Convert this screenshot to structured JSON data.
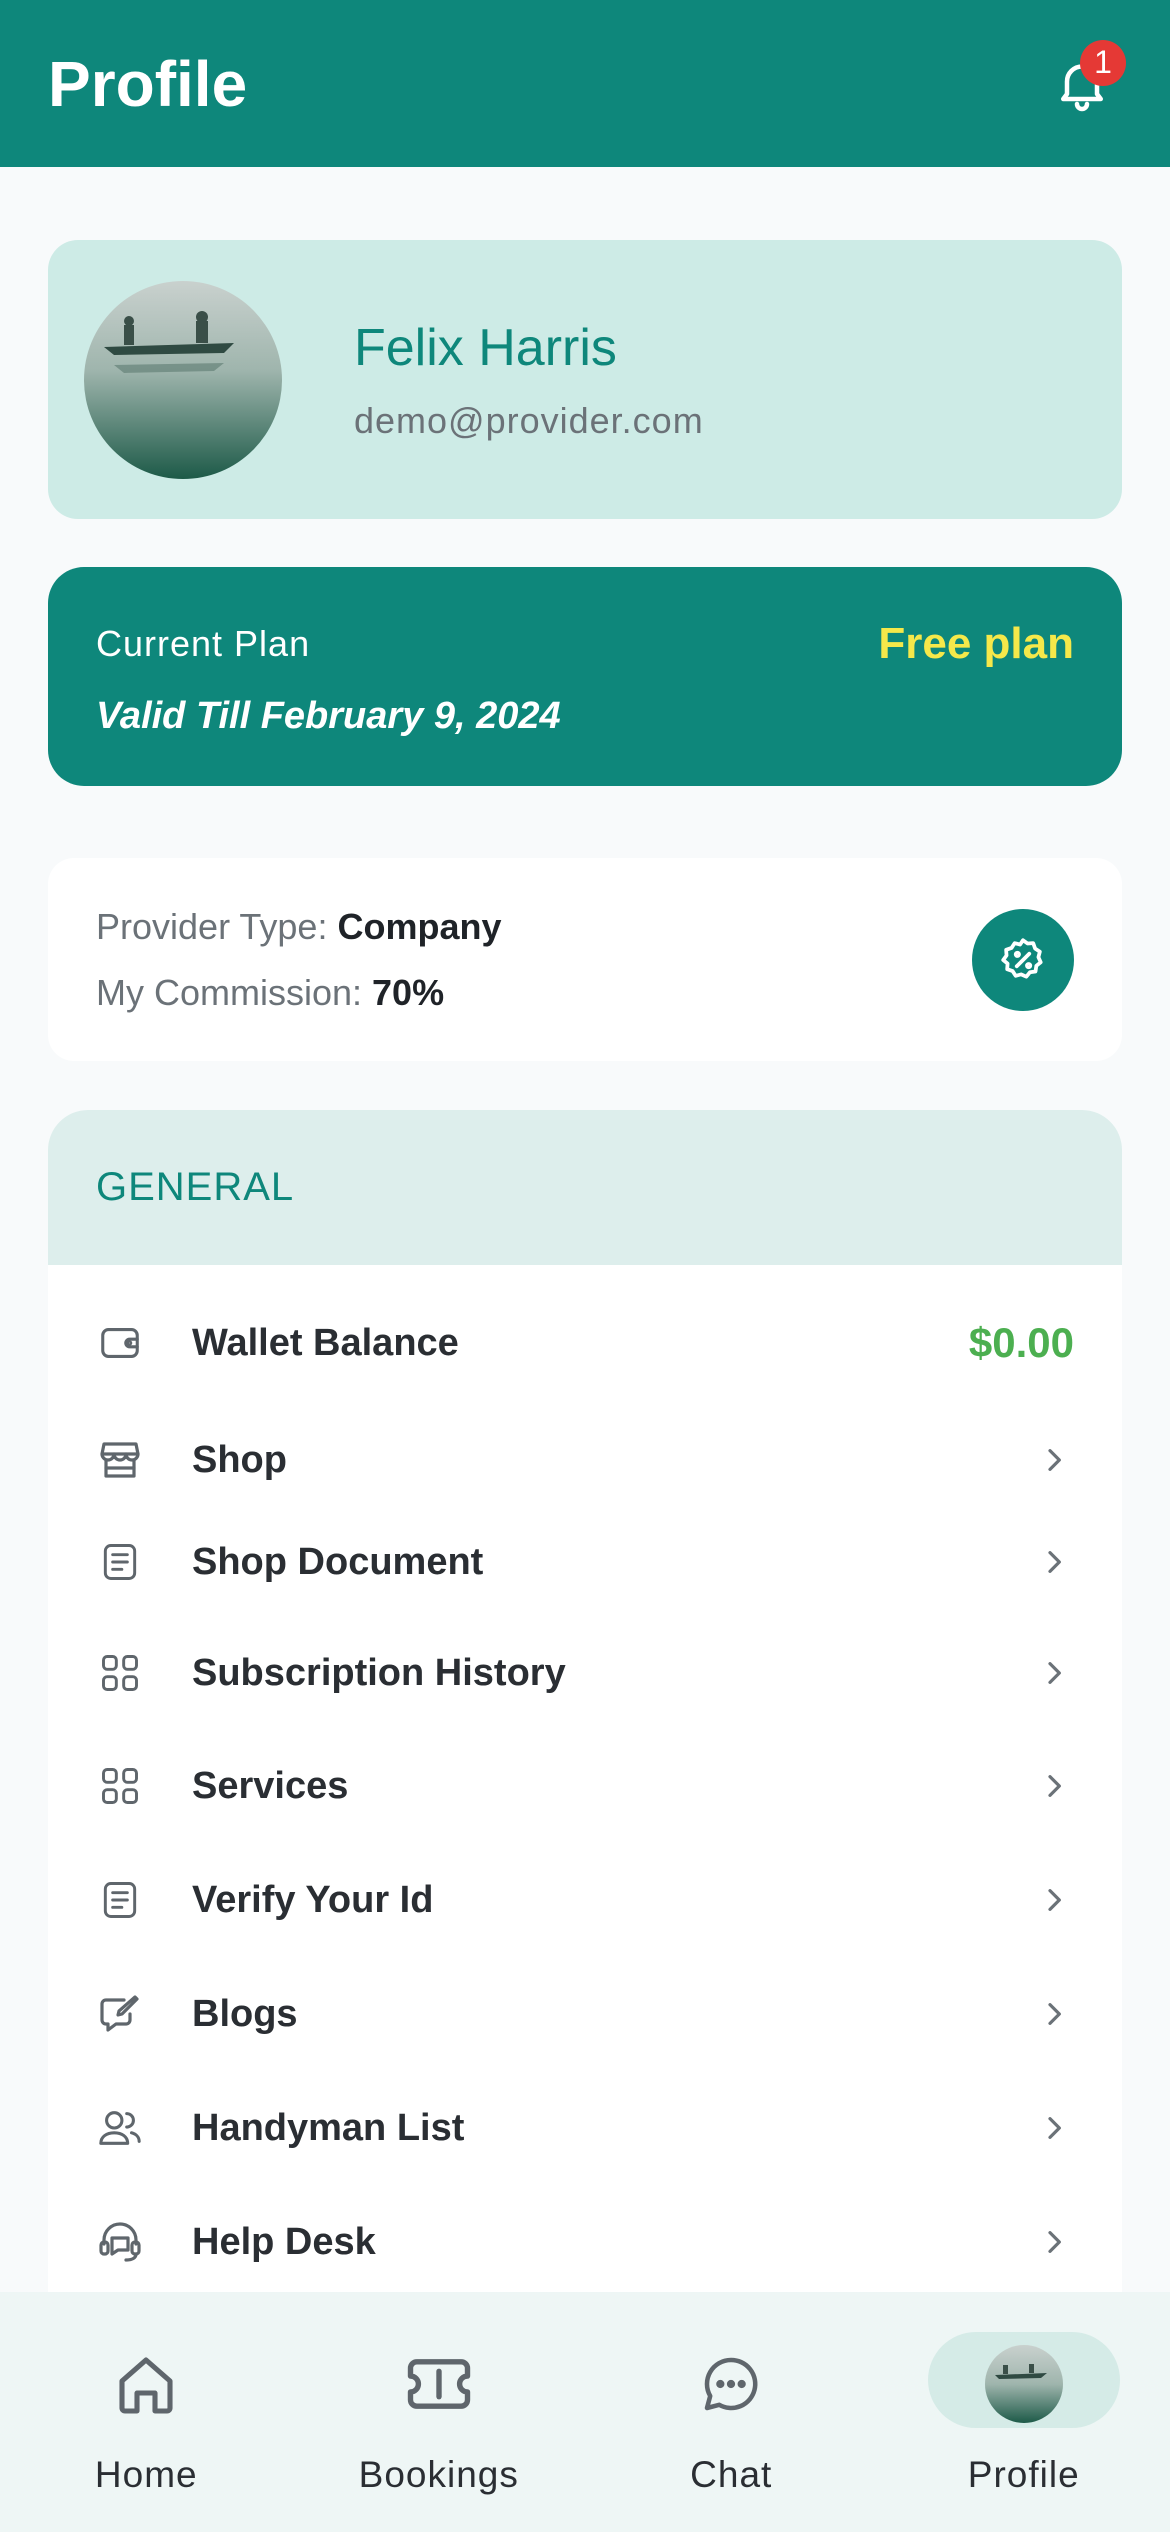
{
  "header": {
    "title": "Profile",
    "notification_count": "1"
  },
  "profile": {
    "name": "Felix Harris",
    "email": "demo@provider.com"
  },
  "plan": {
    "label": "Current Plan",
    "name": "Free plan",
    "valid": "Valid Till February 9, 2024"
  },
  "provider": {
    "type_label": "Provider Type: ",
    "type_value": "Company",
    "commission_label": "My Commission: ",
    "commission_value": "70%"
  },
  "general": {
    "title": "GENERAL",
    "items": [
      {
        "label": "Wallet Balance",
        "value": "$0.00",
        "icon": "wallet-icon"
      },
      {
        "label": "Shop",
        "icon": "store-icon"
      },
      {
        "label": "Shop Document",
        "icon": "document-icon"
      },
      {
        "label": "Subscription History",
        "icon": "grid-icon"
      },
      {
        "label": "Services",
        "icon": "grid-icon"
      },
      {
        "label": "Verify Your Id",
        "icon": "document-icon"
      },
      {
        "label": "Blogs",
        "icon": "edit-message-icon"
      },
      {
        "label": "Handyman List",
        "icon": "users-icon"
      },
      {
        "label": "Help Desk",
        "icon": "headset-icon"
      }
    ]
  },
  "nav": {
    "home": "Home",
    "bookings": "Bookings",
    "chat": "Chat",
    "profile": "Profile"
  },
  "colors": {
    "primary": "#0e877b",
    "accent_yellow": "#f5e84a",
    "wallet_green": "#4caf50"
  }
}
